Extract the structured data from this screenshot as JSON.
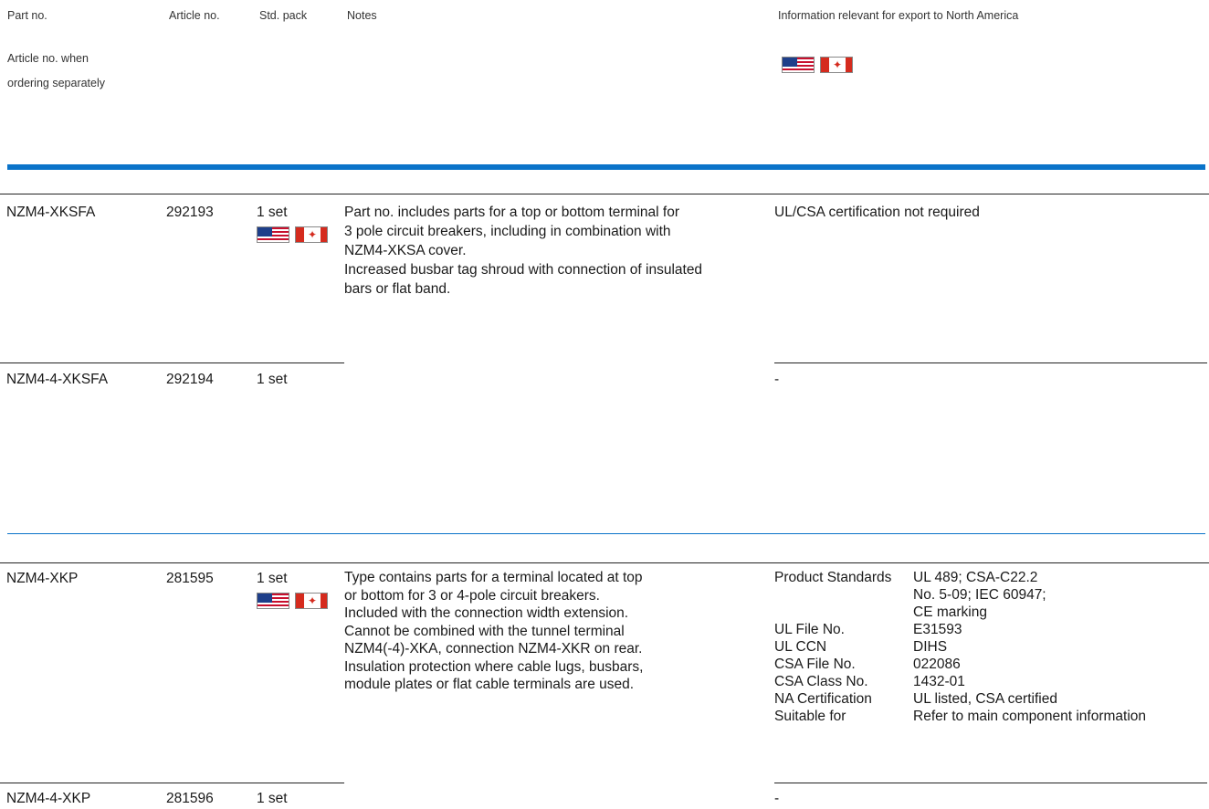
{
  "header": {
    "part_no": "Part no.",
    "article_no": "Article no.",
    "std_pack": "Std. pack",
    "notes": "Notes",
    "export_info": "Information relevant for export to North America",
    "article_separately_1": "Article no. when",
    "article_separately_2": "ordering separately"
  },
  "flags": {
    "us": "us-flag-icon",
    "ca": "canada-flag-icon"
  },
  "colors": {
    "accent_blue": "#0a73c9"
  },
  "group1": {
    "row1": {
      "part": "NZM4-XKSFA",
      "article": "292193",
      "pack": "1 set",
      "notes": [
        "Part no. includes parts for a top or bottom terminal for",
        "3 pole circuit breakers, including in combination with",
        "NZM4-XKSA cover.",
        "Increased busbar tag shroud with connection of insulated",
        "bars or flat band."
      ],
      "export": "UL/CSA certification not required"
    },
    "row2": {
      "part": "NZM4-4-XKSFA",
      "article": "292194",
      "pack": "1 set",
      "export": "-"
    }
  },
  "group2": {
    "row1": {
      "part": "NZM4-XKP",
      "article": "281595",
      "pack": "1 set",
      "notes": [
        "Type contains parts for a terminal located at top",
        "or bottom for 3 or 4-pole circuit breakers.",
        "Included with the connection width extension.",
        "Cannot be combined with the tunnel terminal",
        "NZM4(-4)-XKA, connection NZM4-XKR on rear.",
        "Insulation protection where cable lugs, busbars,",
        "module plates or flat cable terminals are used."
      ],
      "specs": [
        {
          "k": "Product Standards",
          "v": "UL 489; CSA-C22.2\nNo. 5-09; IEC 60947;\nCE marking"
        },
        {
          "k": "UL File No.",
          "v": "E31593"
        },
        {
          "k": "UL CCN",
          "v": "DIHS"
        },
        {
          "k": "CSA File No.",
          "v": "022086"
        },
        {
          "k": "CSA Class No.",
          "v": "1432-01"
        },
        {
          "k": "NA Certification",
          "v": "UL listed, CSA certified"
        },
        {
          "k": "Suitable for",
          "v": "Refer to main component information"
        }
      ]
    },
    "row2": {
      "part": "NZM4-4-XKP",
      "article": "281596",
      "pack": "1 set",
      "export": "-"
    }
  }
}
